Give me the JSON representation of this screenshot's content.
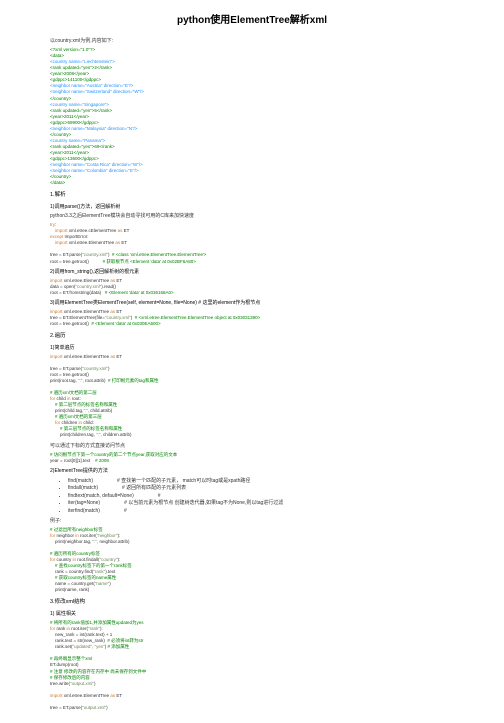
{
  "title": "python使用ElementTree解析xml",
  "intro": "以country.xml为例,内容如下:",
  "xml": {
    "l1": "<?xml version=\"1.0\"?>",
    "l2": "<data>",
    "l3": "    <country name=\"Liechtenstein\">",
    "l4": "        <rank updated=\"yes\">2</rank>",
    "l5": "        <year>2008</year>",
    "l6": "        <gdppc>141100</gdppc>",
    "l7": "        <neighbor name=\"Austria\" direction=\"E\"/>",
    "l8": "        <neighbor name=\"Switzerland\" direction=\"W\"/>",
    "l9": "    </country>",
    "l10": "    <country name=\"Singapore\">",
    "l11": "        <rank updated=\"yes\">5</rank>",
    "l12": "        <year>2011</year>",
    "l13": "        <gdppc>59900</gdppc>",
    "l14": "        <neighbor name=\"Malaysia\" direction=\"N\"/>",
    "l15": "    </country>",
    "l16": "    <country name=\"Panama\">",
    "l17": "        <rank updated=\"yes\">69</rank>",
    "l18": "        <year>2011</year>",
    "l19": "        <gdppc>13600</gdppc>",
    "l20": "        <neighbor name=\"Costa Rica\" direction=\"W\"/>",
    "l21": "        <neighbor name=\"Colombia\" direction=\"E\"/>",
    "l22": "    </country>",
    "l23": "</data>"
  },
  "s1": "1.解析",
  "s1a": "1)调用parse()方法，返回解析树",
  "s1a_note": "python3.3之后ElementTree模块会自动寻找可用的C库来加快速度",
  "c1": {
    "l1": "try:",
    "l2": "    import xml.etree.cElementTree as ET",
    "l3": "except ImportError:",
    "l4": "    import xml.etree.ElementTree as ET",
    "l5": "",
    "l6": "tree = ET.parse(\"country.xml\")  # <class 'xml.etree.ElementTree.ElementTree'>",
    "l7": "root = tree.getroot()           # 获取根节点 <Element 'data' at 0x02BF6A80>"
  },
  "s1b": "2)调用from_string(),返回解析树的根元素",
  "c2": {
    "l1": "import xml.etree.ElementTree as ET",
    "l2": "data = open(\"country.xml\").read()",
    "l3": "root = ET.fromstring(data)   # <Element 'data' at 0x036168A0>"
  },
  "s1c": "3)调用ElementTree类ElementTree(self, element=None, file=None) # 这里的element作为根节点",
  "c3": {
    "l1": "import xml.etree.ElementTree as ET",
    "l2": "tree = ET.ElementTree(file=\"country.xml\")  # <xml.etree.ElementTree.ElementTree object at 0x03031390>",
    "l3": "root = tree.getroot()  # <Element 'data' at 0x030EA600>"
  },
  "s2": "2.遍历",
  "s2a": "1)简单遍历",
  "c4": {
    "l1": "import xml.etree.ElementTree as ET",
    "l2": "",
    "l3": "tree = ET.parse(\"country.xml\")",
    "l4": "root = tree.getroot()",
    "l5": "print(root.tag, \":\", root.attrib)  # 打印根元素的tag和属性",
    "l6": "",
    "l7": "# 遍历xml文档的第二层",
    "l8": "for child in root:",
    "l9": "    # 第二层节点的标签名称和属性",
    "l10": "    print(child.tag,\":\", child.attrib)",
    "l11": "    # 遍历xml文档的第三层",
    "l12": "    for children in child:",
    "l13": "        # 第三层节点的标签名称和属性",
    "l14": "        print(children.tag, \":\", children.attrib)"
  },
  "s2b": "可以通过下标的方式直接访问节点",
  "c5": {
    "l1": "# 访问根节点下第一个country的第二个节点year,获取对应的文本",
    "l2": "year = root[0][1].text    # 2008"
  },
  "s2c": "2)ElementTree提供的方法",
  "mth": {
    "m1": "find(match)",
    "m1d": "# 查找第一个匹配的子元素， match可以时tag或是xpath路径",
    "m2": "findall(match)",
    "m2d": "# 返回所有匹配的子元素列表",
    "m3": "findtext(match, default=None)",
    "m3d": "#",
    "m4": "iter(tag=None)",
    "m4d": "# 以当前元素为根节点 创建树迭代器,如果tag不为None,则以tag进行过滤",
    "m5": "iterfind(match)",
    "m5d": "#"
  },
  "ex": "例子:",
  "c6": {
    "l1": "# 过滤出所有neighbor标签",
    "l2": "for neighbor in root.iter(\"neighbor\"):",
    "l3": "    print(neighbor.tag, \":\", neighbor.attrib)",
    "l4": "",
    "l5": "# 遍历所有的country标签",
    "l6": "for country in root.findall(\"country\"):",
    "l7": "    # 查找country标签下的第一个rank标签",
    "l8": "    rank = country.find(\"rank\").text",
    "l9": "    # 获取country标签的name属性",
    "l10": "    name = country.get(\"name\")",
    "l11": "    print(name, rank)"
  },
  "s3": "3.修改xml结构",
  "s3a": "1) 属性相关",
  "c7": {
    "l1": "# 将所有的rank值加1,并添加属性updated为yes",
    "l2": "for rank in root.iter(\"rank\"):",
    "l3": "    new_rank = int(rank.text) + 1",
    "l4": "    rank.text = str(new_rank)  # 必须将int转为str",
    "l5": "    rank.set(\"updated\", \"yes\") # 添加属性",
    "l6": "",
    "l7": "# 再终端显示整个xml",
    "l8": "ET.dump(root)",
    "l9": "# 注意 修改的内容存在内存中 尚未保存到文件中",
    "l10": "# 保存修改后的内容",
    "l11": "tree.write(\"output.xml\")",
    "l12": "",
    "l13": "import xml.etree.ElementTree as ET",
    "l14": "",
    "l15": "tree = ET.parse(\"output.xml\")"
  }
}
